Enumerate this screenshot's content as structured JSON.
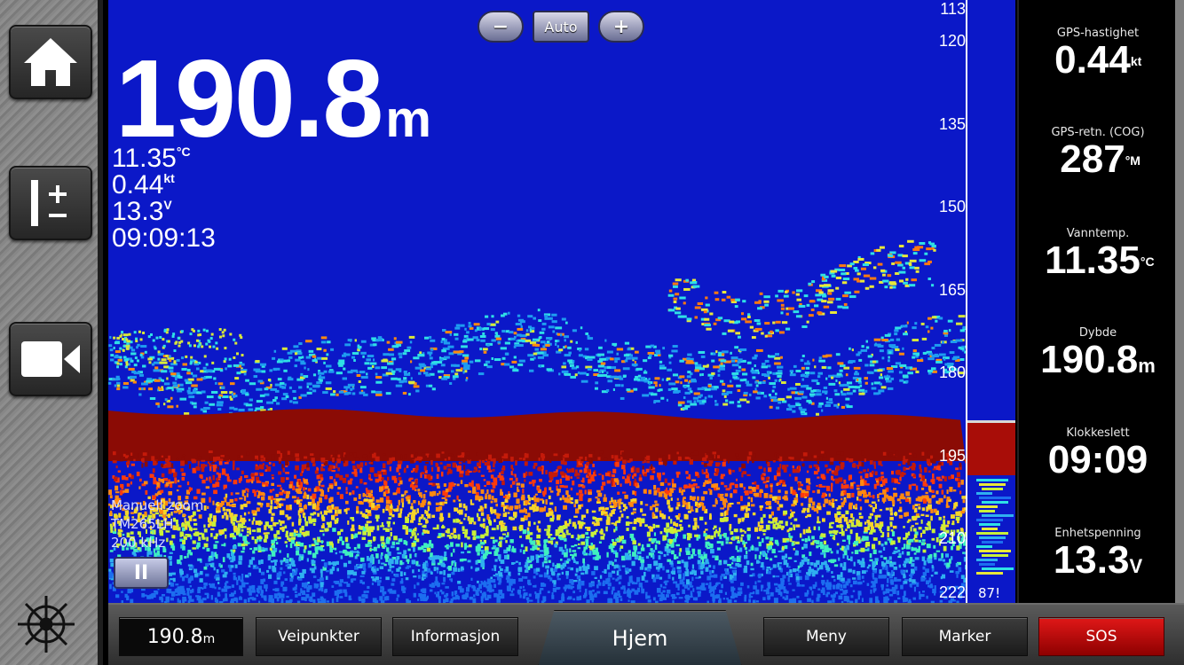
{
  "left_rail": {
    "icons": [
      "home-icon",
      "range-plus-minus-icon",
      "video-camera-icon",
      "helm-icon"
    ]
  },
  "zoom": {
    "minus": "−",
    "auto": "Auto",
    "plus": "+"
  },
  "overlay": {
    "depth_value": "190.8",
    "depth_unit": "m",
    "temp_value": "11.35",
    "temp_unit": "°C",
    "speed_value": "0.44",
    "speed_unit": "kt",
    "volt_value": "13.3",
    "volt_unit": "V",
    "clock": "09:09:13"
  },
  "sonar_info": {
    "mode": "Manuell zoom",
    "transducer": "TM265LH",
    "frequency": "200 kHz",
    "pause_label": "II"
  },
  "depth_scale": {
    "ticks": [
      "113",
      "120",
      "135",
      "150",
      "165",
      "180",
      "195",
      "210",
      "222"
    ],
    "flasher_value": "87!"
  },
  "right_panel": {
    "speed_label": "GPS-hastighet",
    "speed_value": "0.44",
    "speed_unit": "kt",
    "cog_label": "GPS-retn. (COG)",
    "cog_value": "287",
    "cog_unit": "°M",
    "watertemp_label": "Vanntemp.",
    "watertemp_value": "11.35",
    "watertemp_unit": "°C",
    "depth_label": "Dybde",
    "depth_value": "190.8",
    "depth_unit": "m",
    "clock_label": "Klokkeslett",
    "clock_value": "09:09",
    "volt_label": "Enhetspenning",
    "volt_value": "13.3",
    "volt_unit": "V"
  },
  "bottom_bar": {
    "depth_value": "190.8",
    "depth_unit": "m",
    "waypoints": "Veipunkter",
    "info": "Informasjon",
    "home": "Hjem",
    "menu": "Meny",
    "marker": "Marker",
    "sos": "SOS"
  },
  "colors": {
    "water": "#0b18c8",
    "bottom": "#8b0b05",
    "sos": "#d40000"
  }
}
